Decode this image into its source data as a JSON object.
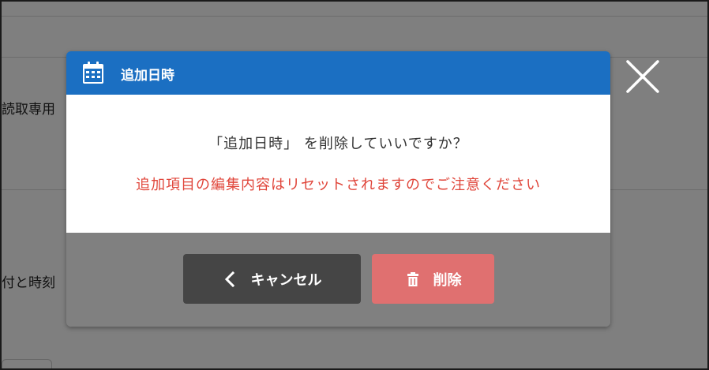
{
  "background": {
    "label_reading": "読取専用",
    "label_datetime": "付と時刻"
  },
  "dialog": {
    "title": "追加日時",
    "message": "「追加日時」 を削除していいですか？",
    "warning": "追加項目の編集内容はリセットされますのでご注意ください",
    "cancel_label": "キャンセル",
    "delete_label": "削除",
    "header_icon": "calendar-icon",
    "close_icon": "close-icon"
  },
  "colors": {
    "header": "#1b6fc2",
    "warning_text": "#e0453a",
    "cancel_button": "#454545",
    "delete_button": "#e07070",
    "footer": "#808080"
  }
}
